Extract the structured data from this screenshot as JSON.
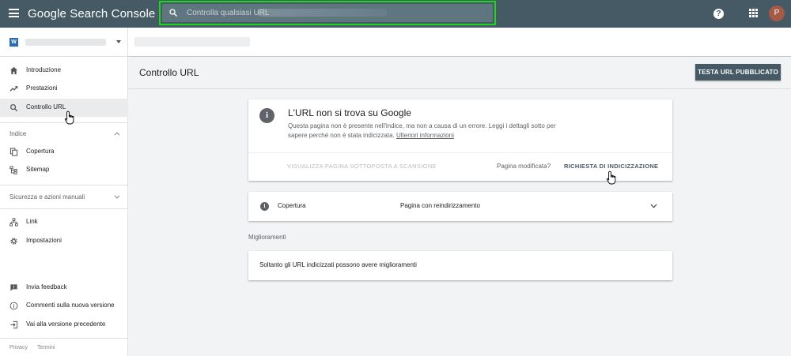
{
  "topbar": {
    "app_title": "Google Search Console",
    "search_placeholder": "Controlla qualsiasi URL",
    "help_symbol": "?",
    "avatar_initial": "P"
  },
  "sidebar": {
    "property_logo_letter": "W",
    "main_items": [
      {
        "label": "Introduzione",
        "icon": "home-icon"
      },
      {
        "label": "Prestazioni",
        "icon": "trending-icon"
      },
      {
        "label": "Controllo URL",
        "icon": "search-icon",
        "active": true
      }
    ],
    "section_index": {
      "label": "Indice",
      "items": [
        {
          "label": "Copertura",
          "icon": "copy-icon"
        },
        {
          "label": "Sitemap",
          "icon": "sitemap-icon"
        }
      ]
    },
    "section_security": {
      "label": "Sicurezza e azioni manuali"
    },
    "other_items": [
      {
        "label": "Link",
        "icon": "link-icon"
      },
      {
        "label": "Impostazioni",
        "icon": "gear-icon"
      }
    ],
    "bottom_items": [
      {
        "label": "Invia feedback",
        "icon": "feedback-icon"
      },
      {
        "label": "Commenti sulla nuova versione",
        "icon": "info-icon"
      },
      {
        "label": "Vai alla versione precedente",
        "icon": "exit-icon"
      }
    ],
    "footer": {
      "privacy": "Privacy",
      "terms": "Termini"
    }
  },
  "main": {
    "page_title": "Controllo URL",
    "test_button": "TESTA URL PUBBLICATO",
    "status_card": {
      "heading": "L'URL non si trova su Google",
      "description": "Questa pagina non è presente nell'indice, ma non a causa di un errore. Leggi i dettagli sotto per sapere perché non è stata indicizzata.",
      "more_link": "Ulteriori informazioni",
      "view_crawled": "VISUALIZZA PAGINA SOTTOPOSTA A SCANSIONE",
      "modified_question": "Pagina modificata?",
      "request_indexing": "RICHIESTA DI INDICIZZAZIONE"
    },
    "coverage_card": {
      "label": "Copertura",
      "value": "Pagina con reindirizzamento"
    },
    "enhancements": {
      "heading": "Miglioramenti",
      "text": "Soltanto gli URL indicizzati possono avere miglioramenti"
    }
  },
  "colors": {
    "topbar": "#455a64",
    "highlight": "#1dd71d",
    "accent": "#455a64"
  }
}
